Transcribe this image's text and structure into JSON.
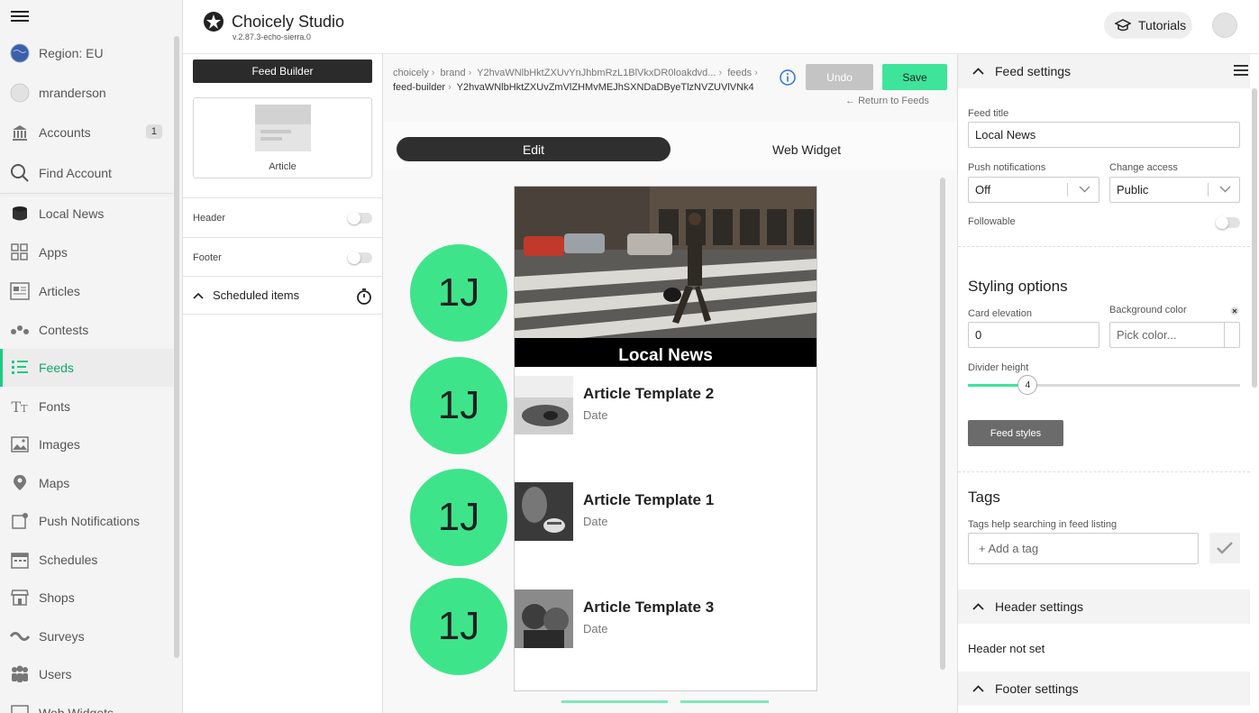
{
  "sidebar": {
    "items": [
      {
        "label": "Region: EU",
        "icon": "globe-icon"
      },
      {
        "label": "mranderson",
        "icon": "user-avatar-icon"
      },
      {
        "label": "Accounts",
        "icon": "bank-icon",
        "badge": "1"
      },
      {
        "label": "Find Account",
        "icon": "search-icon"
      },
      {
        "label": "Local News",
        "icon": "database-icon"
      },
      {
        "label": "Apps",
        "icon": "apps-grid-icon"
      },
      {
        "label": "Articles",
        "icon": "article-icon"
      },
      {
        "label": "Contests",
        "icon": "contest-icon"
      },
      {
        "label": "Feeds",
        "icon": "feed-list-icon",
        "active": true
      },
      {
        "label": "Fonts",
        "icon": "font-icon"
      },
      {
        "label": "Images",
        "icon": "image-icon"
      },
      {
        "label": "Maps",
        "icon": "map-pin-icon"
      },
      {
        "label": "Push Notifications",
        "icon": "notification-icon"
      },
      {
        "label": "Schedules",
        "icon": "calendar-icon"
      },
      {
        "label": "Shops",
        "icon": "shop-icon"
      },
      {
        "label": "Surveys",
        "icon": "survey-icon"
      },
      {
        "label": "Users",
        "icon": "users-icon"
      },
      {
        "label": "Web Widgets",
        "icon": "widget-icon"
      }
    ]
  },
  "header": {
    "title": "Choicely Studio",
    "version": "v.2.87.3-echo-sierra.0",
    "tutorials_label": "Tutorials"
  },
  "builder": {
    "feed_builder_label": "Feed Builder",
    "article_label": "Article",
    "header_label": "Header",
    "footer_label": "Footer",
    "scheduled_label": "Scheduled items"
  },
  "editor": {
    "breadcrumbs": [
      "choicely",
      "brand",
      "Y2hvaWNlbHktZXUvYnJhbmRzL1BlVkxDR0loakdvd...",
      "feeds"
    ],
    "breadcrumbs_line2": [
      "feed-builder",
      "Y2hvaWNlbHktZXUvZmVlZHMvMEJhSXNDaDByeTlzNVZUVlVNk4"
    ],
    "undo_label": "Undo",
    "save_label": "Save",
    "return_label": "Return to Feeds",
    "tab_edit": "Edit",
    "tab_widget": "Web Widget",
    "hero_title": "Local News",
    "avatar_initials": "1J",
    "articles": [
      {
        "title": "Article Template 2",
        "date": "Date"
      },
      {
        "title": "Article Template 1",
        "date": "Date"
      },
      {
        "title": "Article Template 3",
        "date": "Date"
      }
    ]
  },
  "settings": {
    "feed_settings_label": "Feed settings",
    "feed_title_label": "Feed title",
    "feed_title_value": "Local News",
    "push_label": "Push notifications",
    "push_value": "Off",
    "access_label": "Change access",
    "access_value": "Public",
    "followable_label": "Followable",
    "followable_on": false,
    "styling_title": "Styling options",
    "card_elevation_label": "Card elevation",
    "card_elevation_value": "0",
    "bg_color_label": "Background color",
    "bg_color_placeholder": "Pick color...",
    "divider_label": "Divider height",
    "divider_value": "4",
    "divider_fraction": 0.22,
    "feed_styles_label": "Feed styles",
    "tags_title": "Tags",
    "tags_help": "Tags help searching in feed listing",
    "tag_placeholder": "+ Add a tag",
    "header_settings_label": "Header settings",
    "header_not_set": "Header not set",
    "footer_settings_label": "Footer settings"
  },
  "colors": {
    "accent": "#3ee49a",
    "avatar": "#3ee48a",
    "dark": "#2b2b2b"
  }
}
